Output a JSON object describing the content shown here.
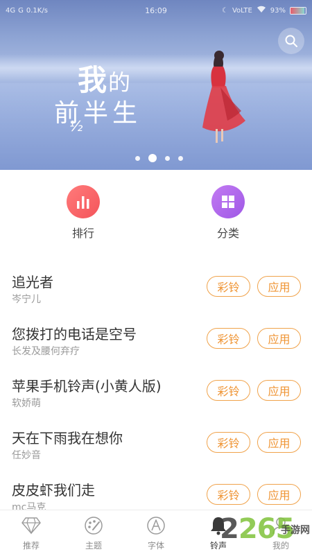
{
  "status_bar": {
    "left": [
      "4G",
      "G",
      "0.1K/s"
    ],
    "time": "16:09",
    "network": "VoLTE",
    "battery": "93%",
    "battery_level": 0.93
  },
  "banner": {
    "title_line1_a": "我",
    "title_line1_b": "的",
    "title_line2": "前半生",
    "title_fraction": "½",
    "carousel_total": 4,
    "carousel_active_index": 1,
    "accent_color": "#d8323f"
  },
  "categories": [
    {
      "label": "排行",
      "icon": "bar-chart-icon",
      "color": "#f4545a"
    },
    {
      "label": "分类",
      "icon": "grid-icon",
      "color": "#a35ce8"
    }
  ],
  "songs": [
    {
      "title": "追光者",
      "artist": "岑宁儿",
      "crbt_label": "彩铃",
      "app_label": "应用"
    },
    {
      "title": "您拨打的电话是空号",
      "artist": "长发及腰何弃疗",
      "crbt_label": "彩铃",
      "app_label": "应用"
    },
    {
      "title": "苹果手机铃声(小黄人版)",
      "artist": "软娇萌",
      "crbt_label": "彩铃",
      "app_label": "应用"
    },
    {
      "title": "天在下雨我在想你",
      "artist": "任妙音",
      "crbt_label": "彩铃",
      "app_label": "应用"
    },
    {
      "title": "皮皮虾我们走",
      "artist": "mc马克",
      "crbt_label": "彩铃",
      "app_label": "应用"
    }
  ],
  "tabbar": {
    "items": [
      {
        "label": "推荐",
        "icon": "diamond-icon"
      },
      {
        "label": "主题",
        "icon": "palette-icon"
      },
      {
        "label": "字体",
        "icon": "font-icon"
      },
      {
        "label": "铃声",
        "icon": "bell-icon",
        "active": true
      },
      {
        "label": "我的",
        "icon": "person-icon"
      }
    ]
  },
  "watermark": {
    "number_a": "2",
    "number_b": "265",
    "text": "手游网"
  },
  "colors": {
    "pill_border": "#f0a24a",
    "pill_text": "#ef9433"
  }
}
